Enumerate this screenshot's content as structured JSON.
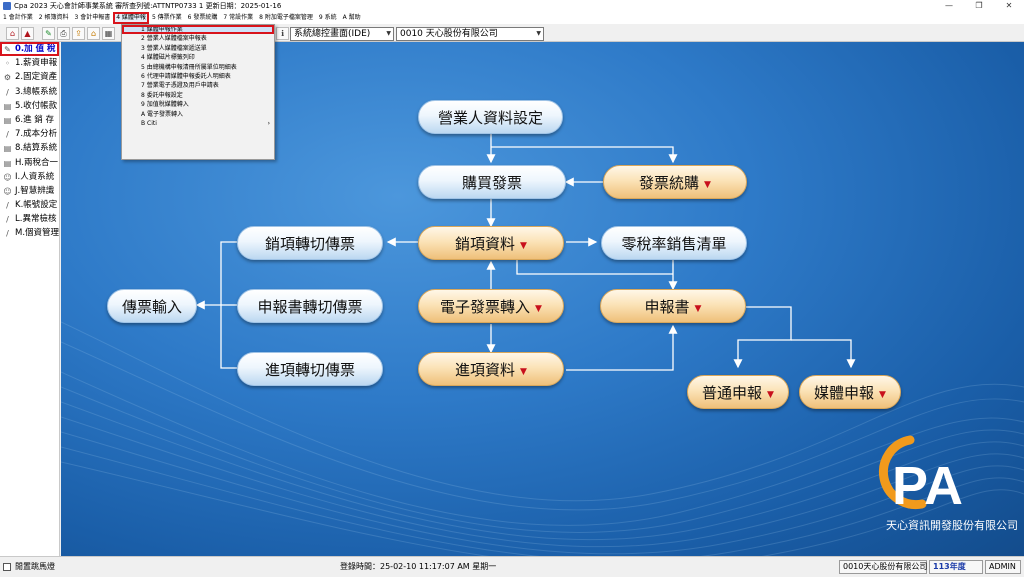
{
  "window": {
    "title": "Cpa 2023  天心會計師事業系統  審所查列號:ATTNTP0733 1   更新日期：2025-01-16",
    "controls": [
      "—",
      "❐",
      "✕"
    ]
  },
  "menu": [
    "1 會計作業",
    "2 帳簿資料",
    "3 會計申報書",
    "4 媒體申報",
    "5 傳票作業",
    "6 發票統購",
    "7 常設作業",
    "8 附加電子檔案管理",
    "9 系統",
    "A 幫助"
  ],
  "toolbar": {
    "icons": [
      "home-icon",
      "building-icon",
      "tool-icon",
      "printer-icon",
      "export-icon",
      "house-icon",
      "calendar-icon",
      "info-icon"
    ],
    "mode_select": "系統總控畫面(IDE)",
    "company_select": "0010  天心股份有限公司"
  },
  "sidebar": [
    {
      "label": "0.加 值 稅",
      "icon": "pen-icon",
      "active": true
    },
    {
      "label": "1.薪資申報",
      "icon": "dot-icon"
    },
    {
      "label": "2.固定資產",
      "icon": "gear-icon"
    },
    {
      "label": "3.總帳系統",
      "icon": "pen-icon"
    },
    {
      "label": "5.收付帳款",
      "icon": "doc-icon"
    },
    {
      "label": "6.進 銷 存",
      "icon": "doc-icon"
    },
    {
      "label": "7.成本分析",
      "icon": "pen-icon"
    },
    {
      "label": "8.結算系統",
      "icon": "doc-icon"
    },
    {
      "label": "H.兩稅合一",
      "icon": "doc-icon"
    },
    {
      "label": "I.人資系統",
      "icon": "person-icon"
    },
    {
      "label": "J.智慧辨識",
      "icon": "person-icon"
    },
    {
      "label": "K.帳號設定",
      "icon": "pen-icon"
    },
    {
      "label": "L.異常檢核",
      "icon": "pen-icon"
    },
    {
      "label": "M.個資管理",
      "icon": "pen-icon"
    }
  ],
  "dropdown": [
    {
      "label": "1 媒體申報作業",
      "selected": true
    },
    {
      "label": "2 營業人媒體檔案申報表"
    },
    {
      "label": "3 營業人媒體檔案遞送單"
    },
    {
      "label": "4 媒體磁片標籤列印"
    },
    {
      "label": "5 由總機構申報清冊所屬單位明細表"
    },
    {
      "label": "6 代理申請媒體申報委託人明細表"
    },
    {
      "label": "7 營業電子憑證及用戶申請表"
    },
    {
      "label": "8 委託申報設定"
    },
    {
      "label": "9 加值稅媒體轉入"
    },
    {
      "label": "A 電子發票轉入"
    },
    {
      "label": "B Citi",
      "submenu": true
    }
  ],
  "flow": {
    "biz_setup": "營業人資料設定",
    "buy_invoice": "購買發票",
    "invoice_purchase": "發票統購",
    "sales_data": "銷項資料",
    "zero_tax_list": "零稅率銷售清單",
    "sales_voucher": "銷項轉切傳票",
    "voucher_input": "傳票輸入",
    "report_voucher": "申報書轉切傳票",
    "einvoice_import": "電子發票轉入",
    "report": "申報書",
    "purchase_voucher": "進項轉切傳票",
    "purchase_data": "進項資料",
    "normal_report": "普通申報",
    "media_report": "媒體申報"
  },
  "brand": {
    "logo_text": "PA",
    "company": "天心資訊開發股份有限公司"
  },
  "status": {
    "checkbox_label": "閒置跳馬燈",
    "login_time": "登錄時間：25-02-10 11:17:07 AM   星期一",
    "company": "0010天心股份有限公司",
    "year": "113年度",
    "user": "ADMIN"
  },
  "colors": {
    "accent_red": "#d8141c",
    "canvas_blue": "#2e7ac8"
  }
}
